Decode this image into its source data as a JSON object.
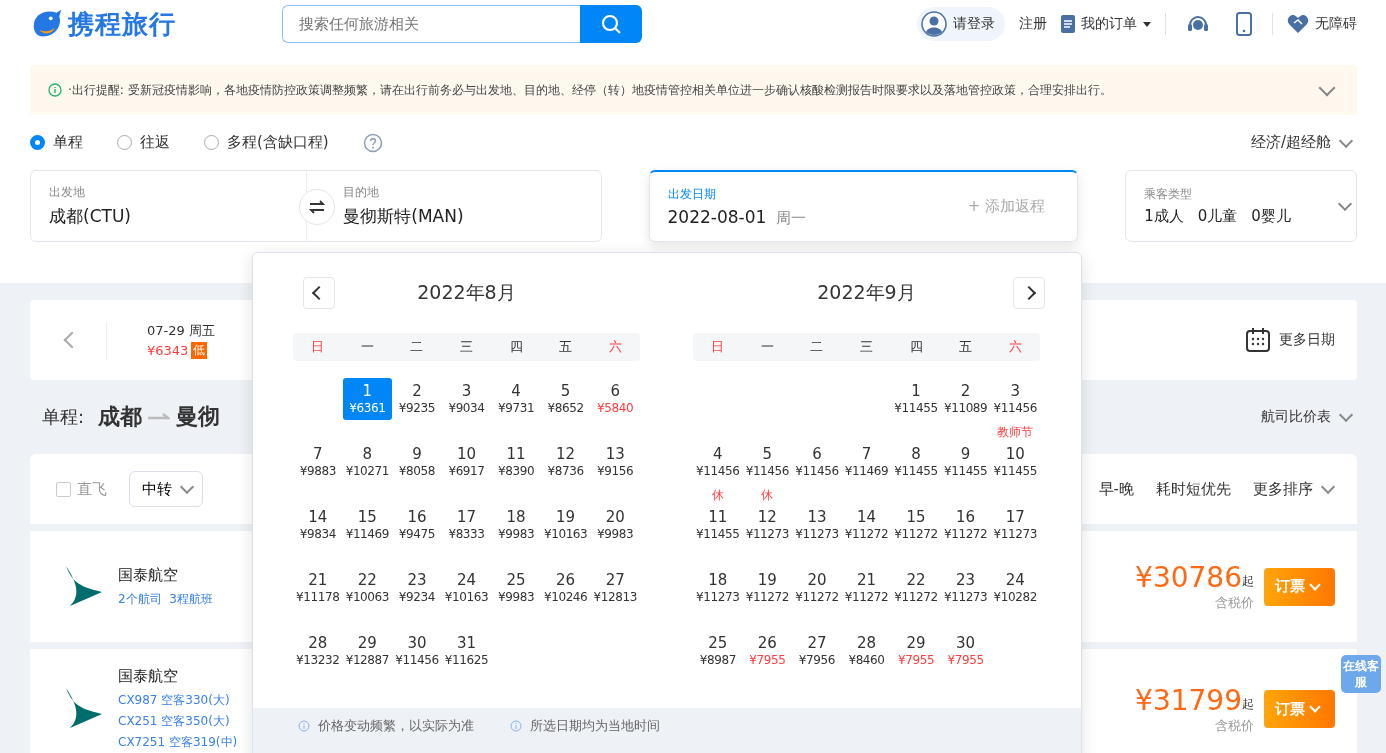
{
  "header": {
    "logo": "携程旅行",
    "search": {
      "placeholder": "搜索任何旅游相关"
    },
    "nav": [
      {
        "kind": "login",
        "label": "请登录"
      },
      {
        "kind": "link",
        "label": "注册"
      },
      {
        "kind": "orders",
        "label": "我的订单"
      },
      {
        "kind": "service"
      },
      {
        "kind": "phone"
      },
      {
        "kind": "access",
        "label": "无障碍"
      }
    ]
  },
  "notice": {
    "text": "·出行提醒: 受新冠疫情影响，各地疫情防控政策调整频繁，请在出行前务必与出发地、目的地、经停（转）地疫情管控相关单位进一步确认核酸检测报告时限要求以及落地管控政策，合理安排出行。"
  },
  "trip_types": [
    {
      "label": "单程",
      "selected": true
    },
    {
      "label": "往返",
      "selected": false
    },
    {
      "label": "多程(含缺口程)",
      "selected": false
    }
  ],
  "cabin": "经济/超经舱",
  "search": {
    "from_label": "出发地",
    "from": "成都(CTU)",
    "to_label": "目的地",
    "to": "曼彻斯特(MAN)",
    "date_label": "出发日期",
    "date": "2022-08-01",
    "weekday": "周一",
    "add_return": "+ 添加返程",
    "pax_label": "乘客类型",
    "pax": [
      "1成人",
      "0儿童",
      "0婴儿"
    ]
  },
  "date_strip": {
    "date": "07-29 周五",
    "price": "¥6343",
    "badge": "低",
    "more": "更多日期"
  },
  "route": {
    "prefix": "单程:",
    "from": "成都",
    "to": "曼彻",
    "compare": "航司比价表"
  },
  "filters": {
    "direct": {
      "label": "直飞",
      "checked": false
    },
    "transfer": "中转",
    "sorts": [
      "早-晚",
      "耗时短优先",
      "更多排序"
    ]
  },
  "flights": [
    {
      "airline": "国泰航空",
      "links": [
        "2个航司  3程航班"
      ],
      "price": "¥30786",
      "from": "起",
      "tax": "含税价",
      "book": "订票"
    },
    {
      "airline": "国泰航空",
      "links": [
        "CX987 空客330(大)",
        "CX251 空客350(大)",
        "CX7251 空客319(中)"
      ],
      "price": "¥31799",
      "from": "起",
      "tax": "含税价",
      "book": "订票"
    }
  ],
  "online_service": "在线客服",
  "calendar": {
    "months": [
      {
        "title": "2022年8月",
        "weekdays": [
          {
            "label": "日",
            "weekend": true
          },
          {
            "label": "一",
            "weekend": false
          },
          {
            "label": "二",
            "weekend": false
          },
          {
            "label": "三",
            "weekend": false
          },
          {
            "label": "四",
            "weekend": false
          },
          {
            "label": "五",
            "weekend": false
          },
          {
            "label": "六",
            "weekend": true
          }
        ],
        "days": [
          {
            "kind": "empty"
          },
          {
            "kind": "day",
            "day": "1",
            "price": "¥6361",
            "low": false,
            "selected": true
          },
          {
            "kind": "day",
            "day": "2",
            "price": "¥9235",
            "low": false,
            "selected": false
          },
          {
            "kind": "day",
            "day": "3",
            "price": "¥9034",
            "low": false,
            "selected": false
          },
          {
            "kind": "day",
            "day": "4",
            "price": "¥9731",
            "low": false,
            "selected": false
          },
          {
            "kind": "day",
            "day": "5",
            "price": "¥8652",
            "low": false,
            "selected": false
          },
          {
            "kind": "day",
            "day": "6",
            "price": "¥5840",
            "low": true,
            "selected": false
          },
          {
            "kind": "day",
            "day": "7",
            "price": "¥9883",
            "low": false,
            "selected": false
          },
          {
            "kind": "day",
            "day": "8",
            "price": "¥10271",
            "low": false,
            "selected": false
          },
          {
            "kind": "day",
            "day": "9",
            "price": "¥8058",
            "low": false,
            "selected": false
          },
          {
            "kind": "day",
            "day": "10",
            "price": "¥6917",
            "low": false,
            "selected": false
          },
          {
            "kind": "day",
            "day": "11",
            "price": "¥8390",
            "low": false,
            "selected": false
          },
          {
            "kind": "day",
            "day": "12",
            "price": "¥8736",
            "low": false,
            "selected": false
          },
          {
            "kind": "day",
            "day": "13",
            "price": "¥9156",
            "low": false,
            "selected": false
          },
          {
            "kind": "day",
            "day": "14",
            "price": "¥9834",
            "low": false,
            "selected": false
          },
          {
            "kind": "day",
            "day": "15",
            "price": "¥11469",
            "low": false,
            "selected": false
          },
          {
            "kind": "day",
            "day": "16",
            "price": "¥9475",
            "low": false,
            "selected": false
          },
          {
            "kind": "day",
            "day": "17",
            "price": "¥8333",
            "low": false,
            "selected": false
          },
          {
            "kind": "day",
            "day": "18",
            "price": "¥9983",
            "low": false,
            "selected": false
          },
          {
            "kind": "day",
            "day": "19",
            "price": "¥10163",
            "low": false,
            "selected": false
          },
          {
            "kind": "day",
            "day": "20",
            "price": "¥9983",
            "low": false,
            "selected": false
          },
          {
            "kind": "day",
            "day": "21",
            "price": "¥11178",
            "low": false,
            "selected": false
          },
          {
            "kind": "day",
            "day": "22",
            "price": "¥10063",
            "low": false,
            "selected": false
          },
          {
            "kind": "day",
            "day": "23",
            "price": "¥9234",
            "low": false,
            "selected": false
          },
          {
            "kind": "day",
            "day": "24",
            "price": "¥10163",
            "low": false,
            "selected": false
          },
          {
            "kind": "day",
            "day": "25",
            "price": "¥9983",
            "low": false,
            "selected": false
          },
          {
            "kind": "day",
            "day": "26",
            "price": "¥10246",
            "low": false,
            "selected": false
          },
          {
            "kind": "day",
            "day": "27",
            "price": "¥12813",
            "low": false,
            "selected": false
          },
          {
            "kind": "day",
            "day": "28",
            "price": "¥13232",
            "low": false,
            "selected": false
          },
          {
            "kind": "day",
            "day": "29",
            "price": "¥12887",
            "low": false,
            "selected": false
          },
          {
            "kind": "day",
            "day": "30",
            "price": "¥11456",
            "low": false,
            "selected": false
          },
          {
            "kind": "day",
            "day": "31",
            "price": "¥11625",
            "low": false,
            "selected": false
          }
        ]
      },
      {
        "title": "2022年9月",
        "weekdays": [
          {
            "label": "日",
            "weekend": true
          },
          {
            "label": "一",
            "weekend": false
          },
          {
            "label": "二",
            "weekend": false
          },
          {
            "label": "三",
            "weekend": false
          },
          {
            "label": "四",
            "weekend": false
          },
          {
            "label": "五",
            "weekend": false
          },
          {
            "label": "六",
            "weekend": true
          }
        ],
        "days": [
          {
            "kind": "empty"
          },
          {
            "kind": "empty"
          },
          {
            "kind": "empty"
          },
          {
            "kind": "empty"
          },
          {
            "kind": "day",
            "day": "1",
            "price": "¥11455",
            "low": false,
            "selected": false
          },
          {
            "kind": "day",
            "day": "2",
            "price": "¥11089",
            "low": false,
            "selected": false
          },
          {
            "kind": "day",
            "day": "3",
            "price": "¥11456",
            "low": false,
            "selected": false
          },
          {
            "kind": "day",
            "day": "4",
            "price": "¥11456",
            "low": false,
            "selected": false
          },
          {
            "kind": "day",
            "day": "5",
            "price": "¥11456",
            "low": false,
            "selected": false
          },
          {
            "kind": "day",
            "day": "6",
            "price": "¥11456",
            "low": false,
            "selected": false
          },
          {
            "kind": "day",
            "day": "7",
            "price": "¥11469",
            "low": false,
            "selected": false
          },
          {
            "kind": "day",
            "day": "8",
            "price": "¥11455",
            "low": false,
            "selected": false
          },
          {
            "kind": "day",
            "day": "9",
            "price": "¥11455",
            "low": false,
            "selected": false
          },
          {
            "kind": "day",
            "day": "10",
            "price": "¥11455",
            "low": false,
            "selected": false,
            "note": "教师节"
          },
          {
            "kind": "day",
            "day": "11",
            "price": "¥11455",
            "low": false,
            "selected": false,
            "note": "休"
          },
          {
            "kind": "day",
            "day": "12",
            "price": "¥11273",
            "low": false,
            "selected": false,
            "note": "休"
          },
          {
            "kind": "day",
            "day": "13",
            "price": "¥11273",
            "low": false,
            "selected": false
          },
          {
            "kind": "day",
            "day": "14",
            "price": "¥11272",
            "low": false,
            "selected": false
          },
          {
            "kind": "day",
            "day": "15",
            "price": "¥11272",
            "low": false,
            "selected": false
          },
          {
            "kind": "day",
            "day": "16",
            "price": "¥11272",
            "low": false,
            "selected": false
          },
          {
            "kind": "day",
            "day": "17",
            "price": "¥11273",
            "low": false,
            "selected": false
          },
          {
            "kind": "day",
            "day": "18",
            "price": "¥11273",
            "low": false,
            "selected": false
          },
          {
            "kind": "day",
            "day": "19",
            "price": "¥11272",
            "low": false,
            "selected": false
          },
          {
            "kind": "day",
            "day": "20",
            "price": "¥11272",
            "low": false,
            "selected": false
          },
          {
            "kind": "day",
            "day": "21",
            "price": "¥11272",
            "low": false,
            "selected": false
          },
          {
            "kind": "day",
            "day": "22",
            "price": "¥11272",
            "low": false,
            "selected": false
          },
          {
            "kind": "day",
            "day": "23",
            "price": "¥11273",
            "low": false,
            "selected": false
          },
          {
            "kind": "day",
            "day": "24",
            "price": "¥10282",
            "low": false,
            "selected": false
          },
          {
            "kind": "day",
            "day": "25",
            "price": "¥8987",
            "low": false,
            "selected": false
          },
          {
            "kind": "day",
            "day": "26",
            "price": "¥7955",
            "low": true,
            "selected": false
          },
          {
            "kind": "day",
            "day": "27",
            "price": "¥7956",
            "low": false,
            "selected": false
          },
          {
            "kind": "day",
            "day": "28",
            "price": "¥8460",
            "low": false,
            "selected": false
          },
          {
            "kind": "day",
            "day": "29",
            "price": "¥7955",
            "low": true,
            "selected": false
          },
          {
            "kind": "day",
            "day": "30",
            "price": "¥7955",
            "low": true,
            "selected": false
          }
        ]
      }
    ],
    "footer_notes": [
      "价格变动频繁，以实际为准",
      "所选日期均为当地时间"
    ]
  }
}
